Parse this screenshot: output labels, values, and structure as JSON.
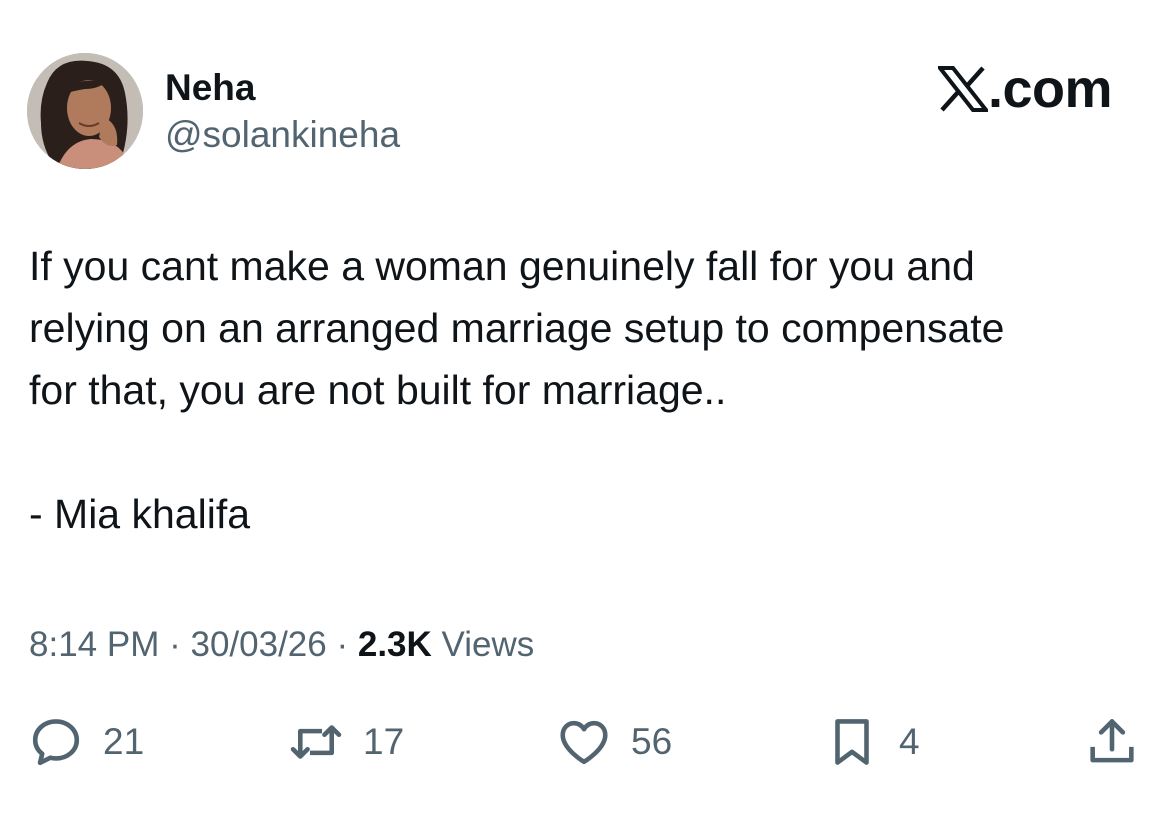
{
  "author": {
    "display_name": "Neha",
    "handle": "@solankineha"
  },
  "brand": {
    "text": ".com",
    "icon": "x-logo-icon"
  },
  "tweet": {
    "lines": [
      "If you cant make a woman genuinely fall for you and",
      "relying on an arranged marriage setup to compensate",
      "for that, you are not built for marriage..",
      "",
      "- Mia khalifa"
    ]
  },
  "meta": {
    "time": "8:14 PM",
    "separator": "·",
    "date": "30/03/26",
    "views_count": "2.3K",
    "views_label": "Views"
  },
  "actions": {
    "reply": {
      "icon": "reply-icon",
      "count": "21"
    },
    "retweet": {
      "icon": "retweet-icon",
      "count": "17"
    },
    "like": {
      "icon": "heart-icon",
      "count": "56"
    },
    "bookmark": {
      "icon": "bookmark-icon",
      "count": "4"
    },
    "share": {
      "icon": "share-icon"
    }
  },
  "colors": {
    "text_primary": "#0f1419",
    "text_secondary": "#536471",
    "background": "#ffffff"
  }
}
